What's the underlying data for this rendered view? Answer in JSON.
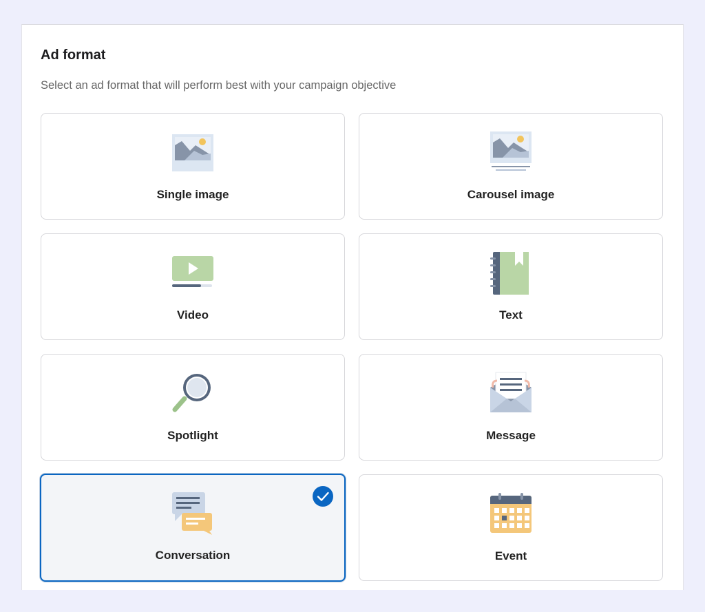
{
  "section": {
    "title": "Ad format",
    "subtitle": "Select an ad format that will perform best with your campaign objective"
  },
  "formats": [
    {
      "label": "Single image",
      "icon": "single-image-icon",
      "selected": false
    },
    {
      "label": "Carousel image",
      "icon": "carousel-image-icon",
      "selected": false
    },
    {
      "label": "Video",
      "icon": "video-icon",
      "selected": false
    },
    {
      "label": "Text",
      "icon": "text-notebook-icon",
      "selected": false
    },
    {
      "label": "Spotlight",
      "icon": "magnifying-glass-icon",
      "selected": false
    },
    {
      "label": "Message",
      "icon": "envelope-letter-icon",
      "selected": false
    },
    {
      "label": "Conversation",
      "icon": "chat-bubbles-icon",
      "selected": true
    },
    {
      "label": "Event",
      "icon": "calendar-icon",
      "selected": false
    }
  ],
  "colors": {
    "accent": "#0a66c2",
    "page_background": "#eeeffc",
    "selected_card_background": "#f3f5f8"
  }
}
